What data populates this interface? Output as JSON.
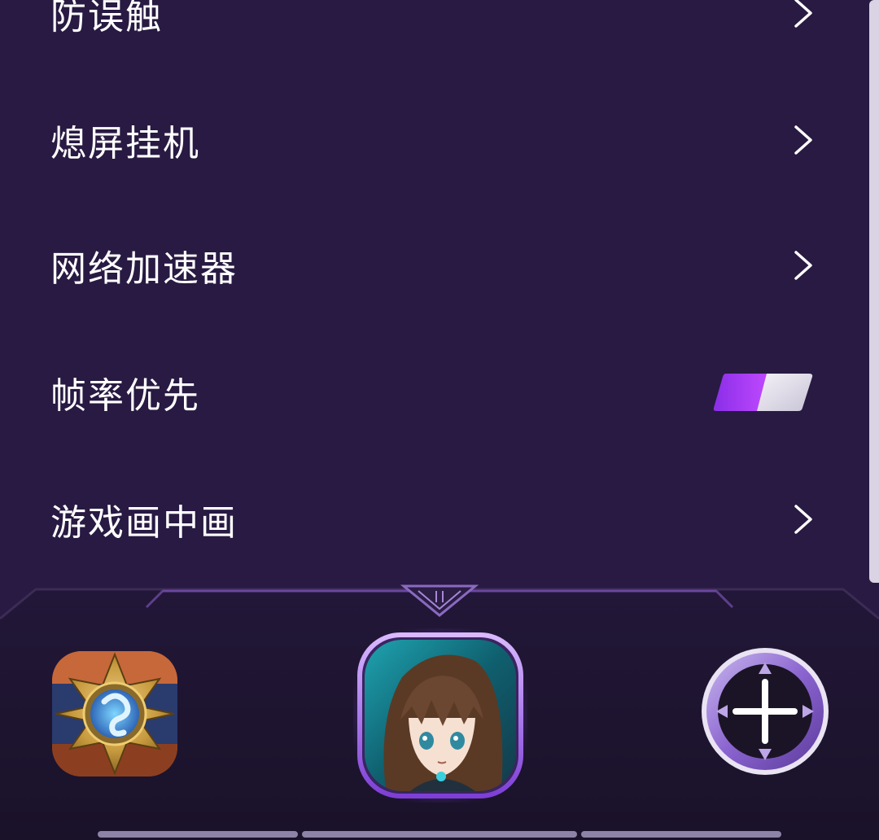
{
  "menu": {
    "items": [
      {
        "label": "防误触",
        "control": "chevron"
      },
      {
        "label": "熄屏挂机",
        "control": "chevron"
      },
      {
        "label": "网络加速器",
        "control": "chevron"
      },
      {
        "label": "帧率优先",
        "control": "toggle",
        "toggle_on": true
      },
      {
        "label": "游戏画中画",
        "control": "chevron"
      }
    ]
  },
  "dock": {
    "apps": [
      {
        "icon": "hearthstone-app-icon"
      },
      {
        "icon": "anime-character-app-icon",
        "selected": true
      }
    ],
    "add_icon": "plus-icon"
  },
  "colors": {
    "background": "#281a42",
    "dock_background": "#1c1430",
    "accent": "#9b3df0",
    "text": "#ffffff"
  }
}
